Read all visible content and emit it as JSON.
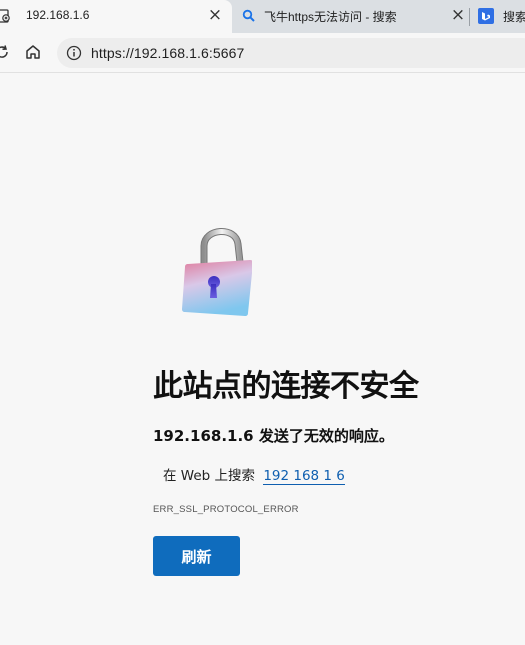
{
  "tabs": [
    {
      "title": "192.168.1.6",
      "icon": "broken-lock-page-icon",
      "active": true
    },
    {
      "title": "飞牛https无法访问 - 搜索",
      "icon": "search-icon",
      "active": false
    },
    {
      "title": "搜索",
      "icon": "bing-icon",
      "active": false
    }
  ],
  "tab_close_glyph": "×",
  "address_bar": {
    "url": "https://192.168.1.6:5667"
  },
  "error_page": {
    "title": "此站点的连接不安全",
    "description": "192.168.1.6 发送了无效的响应。",
    "search_prefix": "在 Web 上搜索",
    "search_link": "192 168 1 6",
    "error_code": "ERR_SSL_PROTOCOL_ERROR",
    "reload_label": "刷新"
  },
  "colors": {
    "accent": "#0f6cbd",
    "link": "#0f5fb0"
  }
}
